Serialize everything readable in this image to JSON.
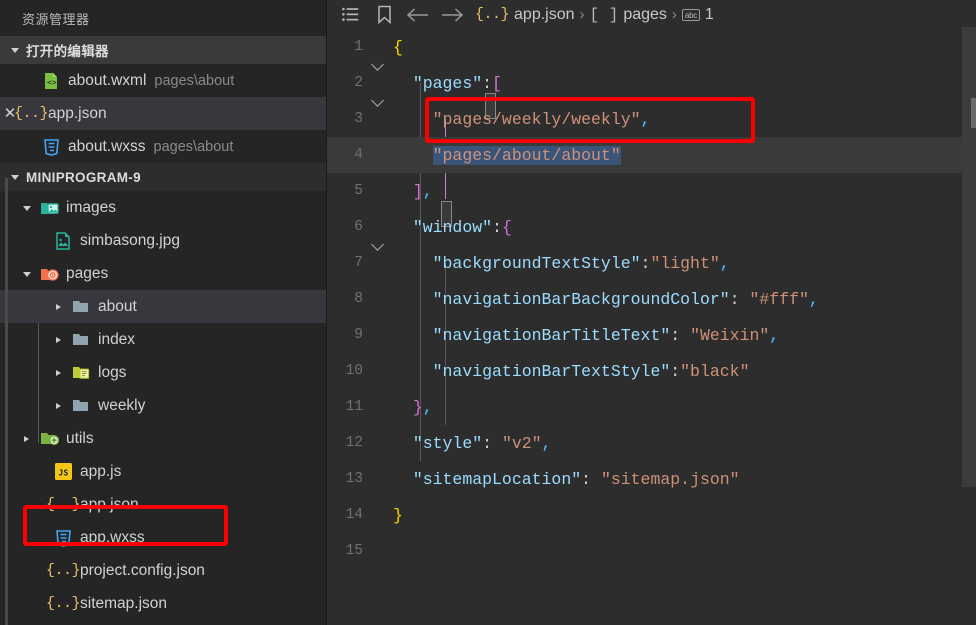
{
  "sidebar": {
    "title": "资源管理器",
    "open_editors": {
      "label": "打开的编辑器",
      "items": [
        {
          "name": "about.wxml",
          "path": "pages\\about",
          "icon": "wxml-file-icon",
          "close": "",
          "active": false
        },
        {
          "name": "app.json",
          "path": "",
          "icon": "json-file-icon",
          "close": "✕",
          "active": true
        },
        {
          "name": "about.wxss",
          "path": "pages\\about",
          "icon": "wxss-file-icon",
          "close": "",
          "active": false
        }
      ]
    },
    "project": {
      "label": "MINIPROGRAM-9",
      "items": [
        {
          "name": "images",
          "type": "folder-images",
          "depth": 1,
          "expanded": true
        },
        {
          "name": "simbasong.jpg",
          "type": "image-file",
          "depth": 2,
          "expanded": null
        },
        {
          "name": "pages",
          "type": "folder-pages",
          "depth": 1,
          "expanded": true
        },
        {
          "name": "about",
          "type": "folder",
          "depth": 2,
          "expanded": false,
          "selected": true
        },
        {
          "name": "index",
          "type": "folder",
          "depth": 2,
          "expanded": false
        },
        {
          "name": "logs",
          "type": "folder-logs",
          "depth": 2,
          "expanded": false
        },
        {
          "name": "weekly",
          "type": "folder",
          "depth": 2,
          "expanded": false
        },
        {
          "name": "utils",
          "type": "folder-utils",
          "depth": 1,
          "expanded": false
        },
        {
          "name": "app.js",
          "type": "js-file",
          "depth": 1,
          "expanded": null
        },
        {
          "name": "app.json",
          "type": "json-file",
          "depth": 1,
          "expanded": null,
          "highlighted": true
        },
        {
          "name": "app.wxss",
          "type": "wxss-file",
          "depth": 1,
          "expanded": null
        },
        {
          "name": "project.config.json",
          "type": "json-file",
          "depth": 1,
          "expanded": null
        },
        {
          "name": "sitemap.json",
          "type": "json-file",
          "depth": 1,
          "expanded": null
        }
      ]
    }
  },
  "breadcrumb": {
    "icons": [
      "outline-list-icon",
      "bookmark-icon",
      "arrow-left-icon",
      "arrow-right-icon"
    ],
    "items": [
      {
        "icon": "json-file-icon",
        "text": "app.json"
      },
      {
        "icon": "array-bracket-icon",
        "text": "pages"
      },
      {
        "icon": "abc-string-icon",
        "text": "1"
      }
    ],
    "separator": "›"
  },
  "editor": {
    "file": "app.json",
    "lines": [
      {
        "num": "1",
        "fold": "open",
        "text": "{"
      },
      {
        "num": "2",
        "fold": "open",
        "text": "  \"pages\":["
      },
      {
        "num": "3",
        "fold": "",
        "text": "    \"pages/weekly/weekly\","
      },
      {
        "num": "4",
        "fold": "",
        "text": "    \"pages/about/about\""
      },
      {
        "num": "5",
        "fold": "",
        "text": "  ],"
      },
      {
        "num": "6",
        "fold": "open",
        "text": "  \"window\":{"
      },
      {
        "num": "7",
        "fold": "",
        "text": "    \"backgroundTextStyle\":\"light\","
      },
      {
        "num": "8",
        "fold": "",
        "text": "    \"navigationBarBackgroundColor\": \"#fff\","
      },
      {
        "num": "9",
        "fold": "",
        "text": "    \"navigationBarTitleText\": \"Weixin\","
      },
      {
        "num": "10",
        "fold": "",
        "text": "    \"navigationBarTextStyle\":\"black\""
      },
      {
        "num": "11",
        "fold": "",
        "text": "  },"
      },
      {
        "num": "12",
        "fold": "",
        "text": "  \"style\": \"v2\","
      },
      {
        "num": "13",
        "fold": "",
        "text": "  \"sitemapLocation\": \"sitemap.json\""
      },
      {
        "num": "14",
        "fold": "",
        "text": "}"
      },
      {
        "num": "15",
        "fold": "",
        "text": ""
      }
    ],
    "current_line": "4",
    "selection_text": "\"pages/about/about\""
  },
  "annotations": [
    {
      "name": "code-line-3-highlight",
      "target": "pages/weekly/weekly"
    },
    {
      "name": "sidebar-app-json-highlight",
      "target": "app.json"
    }
  ],
  "colors": {
    "annotation_red": "#fb0000",
    "json_key": "#9cdcfe",
    "json_string": "#ce9178",
    "brace_yellow": "#ffd700",
    "brace_magenta": "#da70d6",
    "selection_blue": "#3a5579",
    "editor_bg": "#2d2d2d",
    "sidebar_bg": "#252526"
  }
}
